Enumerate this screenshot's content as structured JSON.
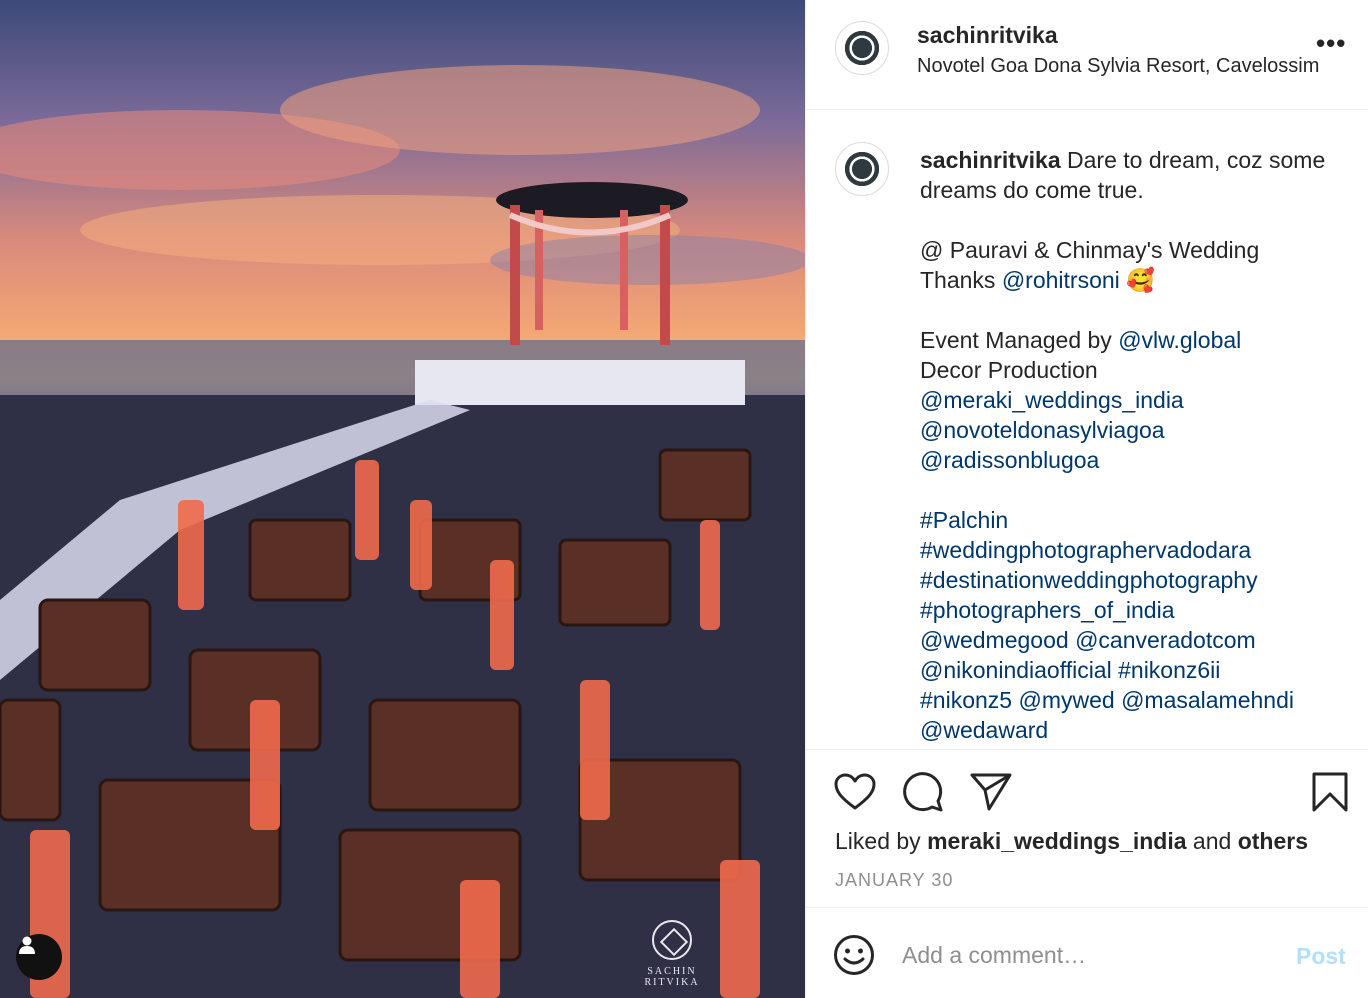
{
  "post": {
    "username": "sachinritvika",
    "location": "Novotel Goa Dona Sylvia Resort, Cavelossim",
    "more_label": "•••"
  },
  "photo": {
    "watermark_text": "SACHIN RITVIKA"
  },
  "caption": {
    "username": "sachinritvika",
    "line1": "Dare to dream, coz some dreams do come true.",
    "line2a": "@ Pauravi & Chinmay's Wedding",
    "line3a": "Thanks ",
    "line3_link": "@rohitrsoni",
    "line3_emoji": "🥰",
    "line4a": "Event Managed by ",
    "line4_link": "@vlw.global",
    "line5": "Decor Production",
    "links": [
      "@meraki_weddings_india",
      "@novoteldonasylviagoa",
      "@radissonblugoa"
    ],
    "hashtags": [
      "#Palchin",
      "#weddingphotographervadodara",
      "#destinationweddingphotography",
      "#photographers_of_india"
    ],
    "mentions_line1": [
      "@wedmegood",
      "@canveradotcom"
    ],
    "mentions_line2": [
      "@nikonindiaofficial",
      "#nikonz6ii"
    ],
    "mentions_line3": [
      "#nikonz5",
      "@mywed",
      "@masalamehndi"
    ],
    "mentions_line4": "@wedaward"
  },
  "likes": {
    "prefix": "Liked by ",
    "user": "meraki_weddings_india",
    "middle": " and ",
    "others": "others"
  },
  "date": "JANUARY 30",
  "comment_box": {
    "placeholder": "Add a comment…",
    "post_label": "Post"
  },
  "icons": {
    "like": "heart-icon",
    "comment": "comment-icon",
    "share": "share-icon",
    "save": "bookmark-icon",
    "emoji": "emoji-icon",
    "tag": "user-tag-icon"
  },
  "colors": {
    "link": "#00376b",
    "muted": "#8e8e8e",
    "post_disabled": "#b2dffc"
  }
}
